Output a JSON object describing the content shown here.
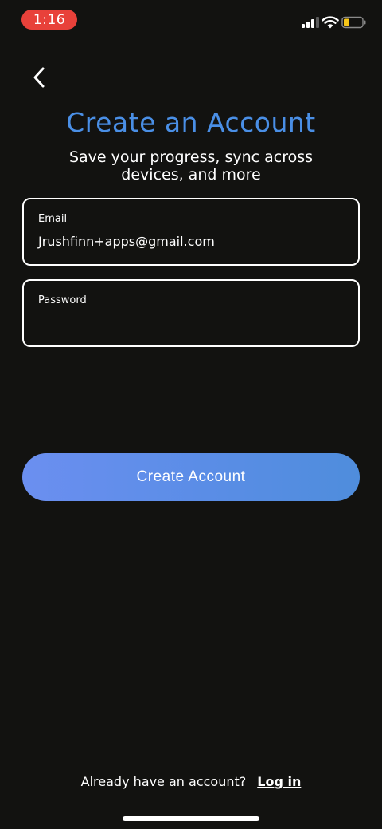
{
  "status_bar": {
    "time": "1:16",
    "time_pill_color": "#e8413a",
    "icons": [
      "cellular-signal-icon",
      "wifi-icon",
      "battery-low-icon"
    ]
  },
  "nav": {
    "back_icon": "chevron-left-icon"
  },
  "header": {
    "title": "Create an Account",
    "subtitle": "Save your progress, sync across devices, and more",
    "title_color": "#4a8fe6"
  },
  "form": {
    "email": {
      "label": "Email",
      "value": "Jrushfinn+apps@gmail.com"
    },
    "password": {
      "label": "Password",
      "value": ""
    }
  },
  "actions": {
    "create_account_label": "Create Account"
  },
  "footer": {
    "prompt": "Already have an account?",
    "login_label": "Log in"
  }
}
